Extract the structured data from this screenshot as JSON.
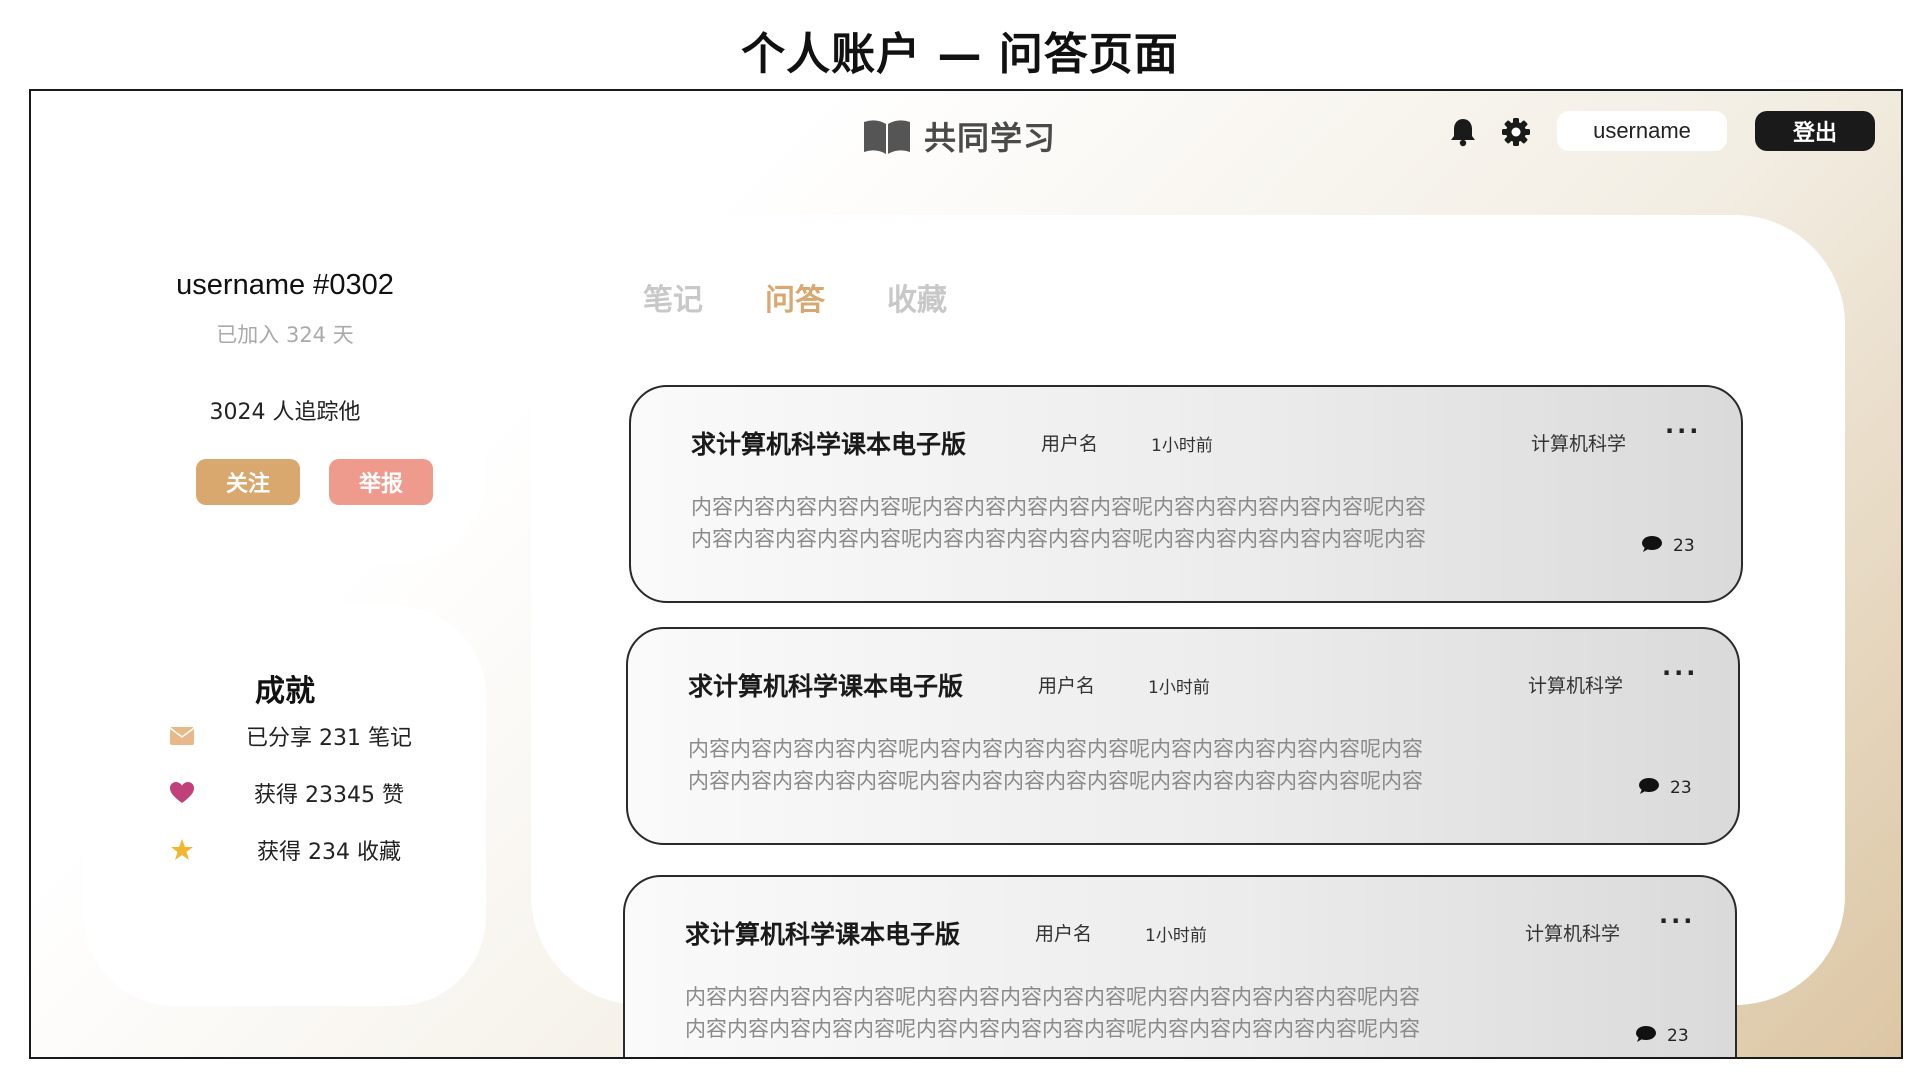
{
  "page_caption": "个人账户 — 问答页面",
  "header": {
    "logo_text": "共同学习",
    "username": "username",
    "logout_label": "登出",
    "icons": [
      "book-icon",
      "bell-icon",
      "gear-icon"
    ]
  },
  "profile": {
    "name": "username #0302",
    "joined": "已加入 324 天",
    "followers": "3024 人追踪他",
    "follow_label": "关注",
    "report_label": "举报",
    "colors": {
      "follow": "#d9a86e",
      "report": "#ee9a8c"
    }
  },
  "achievements": {
    "title": "成就",
    "items": [
      {
        "icon": "envelope-icon",
        "text": "已分享 231 笔记"
      },
      {
        "icon": "heart-icon",
        "text": "获得 23345 赞"
      },
      {
        "icon": "star-icon",
        "text": "获得 234 收藏"
      }
    ]
  },
  "tabs": [
    {
      "label": "笔记",
      "active": false
    },
    {
      "label": "问答",
      "active": true
    },
    {
      "label": "收藏",
      "active": false
    }
  ],
  "accent_color": "#d9a86e",
  "questions": [
    {
      "title": "求计算机科学课本电子版",
      "author": "用户名",
      "time": "1小时前",
      "category": "计算机科学",
      "more": "···",
      "body_line1": "内容内容内容内容内容呢内容内容内容内容内容呢内容内容内容内容内容呢内容",
      "body_line2": "内容内容内容内容内容呢内容内容内容内容内容呢内容内容内容内容内容呢内容",
      "comments": "23"
    },
    {
      "title": "求计算机科学课本电子版",
      "author": "用户名",
      "time": "1小时前",
      "category": "计算机科学",
      "more": "···",
      "body_line1": "内容内容内容内容内容呢内容内容内容内容内容呢内容内容内容内容内容呢内容",
      "body_line2": "内容内容内容内容内容呢内容内容内容内容内容呢内容内容内容内容内容呢内容",
      "comments": "23"
    },
    {
      "title": "求计算机科学课本电子版",
      "author": "用户名",
      "time": "1小时前",
      "category": "计算机科学",
      "more": "···",
      "body_line1": "内容内容内容内容内容呢内容内容内容内容内容呢内容内容内容内容内容呢内容",
      "body_line2": "内容内容内容内容内容呢内容内容内容内容内容呢内容内容内容内容内容呢内容",
      "comments": "23"
    }
  ]
}
